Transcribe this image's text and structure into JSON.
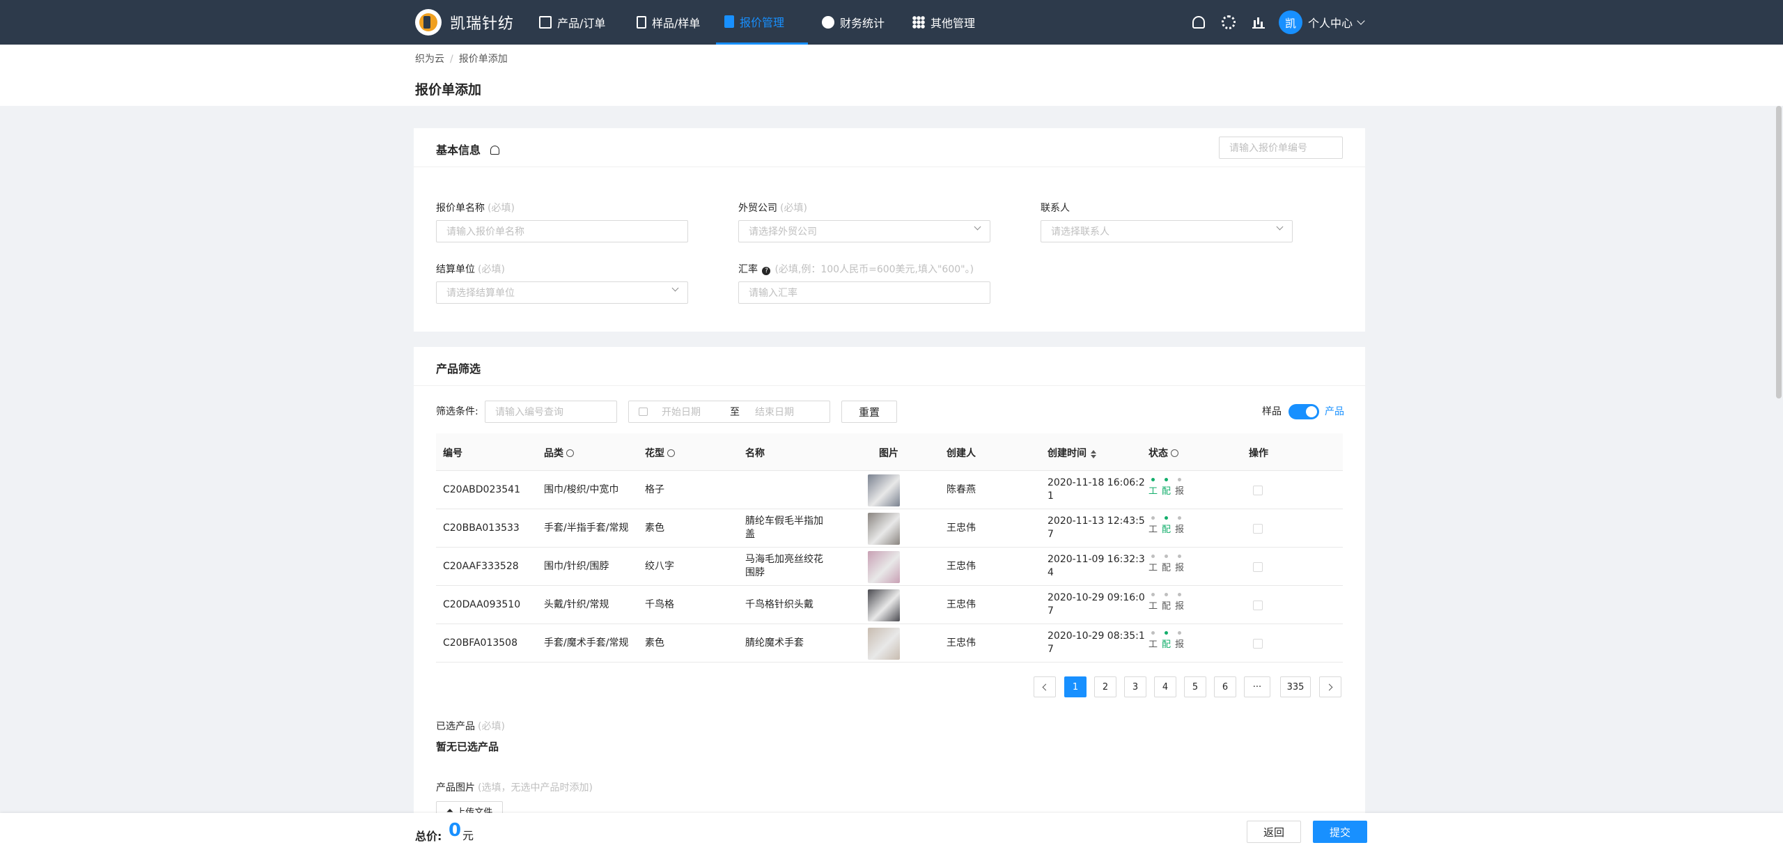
{
  "app": {
    "brand": "凯瑞针纺"
  },
  "nav": [
    {
      "label": "产品/订单",
      "icon": "cube-icon"
    },
    {
      "label": "样品/样单",
      "icon": "clipboard-icon"
    },
    {
      "label": "报价管理",
      "icon": "document-icon",
      "active": true
    },
    {
      "label": "财务统计",
      "icon": "coin-icon"
    },
    {
      "label": "其他管理",
      "icon": "grid-icon"
    }
  ],
  "user": {
    "avatar": "凯",
    "label": "个人中心"
  },
  "breadcrumb": {
    "root": "织为云",
    "separator": "/",
    "current": "报价单添加"
  },
  "page_title": "报价单添加",
  "basic": {
    "title": "基本信息",
    "code_placeholder": "请输入报价单编号",
    "fields": {
      "name": {
        "label": "报价单名称",
        "hint": "(必填)",
        "placeholder": "请输入报价单名称"
      },
      "company": {
        "label": "外贸公司",
        "hint": "(必填)",
        "placeholder": "请选择外贸公司"
      },
      "contact": {
        "label": "联系人",
        "placeholder": "请选择联系人"
      },
      "unit": {
        "label": "结算单位",
        "hint": "(必填)",
        "placeholder": "请选择结算单位"
      },
      "rate": {
        "label": "汇率",
        "hint": "(必填,例：100人民币=600美元,填入\"600\"。)",
        "placeholder": "请输入汇率",
        "help_icon": "?"
      }
    }
  },
  "filter": {
    "title": "产品筛选",
    "label": "筛选条件:",
    "code_placeholder": "请输入编号查询",
    "start_placeholder": "开始日期",
    "range_sep": "至",
    "end_placeholder": "结束日期",
    "reset": "重置",
    "toggle_left": "样品",
    "toggle_right": "产品",
    "toggle_on": true
  },
  "table": {
    "headers": [
      "编号",
      "品类",
      "花型",
      "名称",
      "图片",
      "创建人",
      "创建时间",
      "状态",
      "操作"
    ],
    "status_letters": [
      "工",
      "配",
      "报"
    ],
    "rows": [
      {
        "code": "C20ABD023541",
        "category": "围巾/梭织/中宽巾",
        "pattern": "格子",
        "name": "",
        "creator": "陈春燕",
        "time_l1": "2020-11-18 16:06:2",
        "time_l2": "1",
        "status": [
          true,
          true,
          false
        ],
        "thumb_color": "#7a8290"
      },
      {
        "code": "C20BBA013533",
        "category": "手套/半指手套/常规",
        "pattern": "素色",
        "name_l1": "腈纶车假毛半指加",
        "name_l2": "盖",
        "creator": "王忠伟",
        "time_l1": "2020-11-13 12:43:5",
        "time_l2": "7",
        "status": [
          false,
          true,
          false
        ],
        "thumb_color": "#8a8580"
      },
      {
        "code": "C20AAF333528",
        "category": "围巾/针织/围脖",
        "pattern": "绞八字",
        "name_l1": "马海毛加亮丝绞花",
        "name_l2": "围脖",
        "creator": "王忠伟",
        "time_l1": "2020-11-09 16:32:3",
        "time_l2": "4",
        "status": [
          false,
          false,
          false
        ],
        "thumb_color": "#c8a0b4"
      },
      {
        "code": "C20DAA093510",
        "category": "头戴/针织/常规",
        "pattern": "千鸟格",
        "name_l1": "千鸟格针织头戴",
        "name_l2": "",
        "creator": "王忠伟",
        "time_l1": "2020-10-29 09:16:0",
        "time_l2": "7",
        "status": [
          false,
          false,
          false
        ],
        "thumb_color": "#4a4a50"
      },
      {
        "code": "C20BFA013508",
        "category": "手套/魔术手套/常规",
        "pattern": "素色",
        "name_l1": "腈纶魔术手套",
        "name_l2": "",
        "creator": "王忠伟",
        "time_l1": "2020-10-29 08:35:1",
        "time_l2": "7",
        "status": [
          false,
          true,
          false
        ],
        "thumb_color": "#c8bcb0"
      }
    ]
  },
  "pagination": {
    "pages": [
      "1",
      "2",
      "3",
      "4",
      "5",
      "6"
    ],
    "ellipsis": "···",
    "last": "335",
    "current": 1
  },
  "selected": {
    "label": "已选产品",
    "hint": "(必填)",
    "empty_text": "暂无已选产品"
  },
  "images": {
    "label": "产品图片",
    "hint": "(选填，无选中产品时添加)",
    "upload": "上传文件"
  },
  "footer": {
    "total_label": "总价:",
    "total_value": "0",
    "unit": "元",
    "back": "返回",
    "submit": "提交"
  },
  "colors": {
    "nav_bg": "#2d3a4b",
    "accent": "#1890ff",
    "status_on": "#13ae6b"
  }
}
